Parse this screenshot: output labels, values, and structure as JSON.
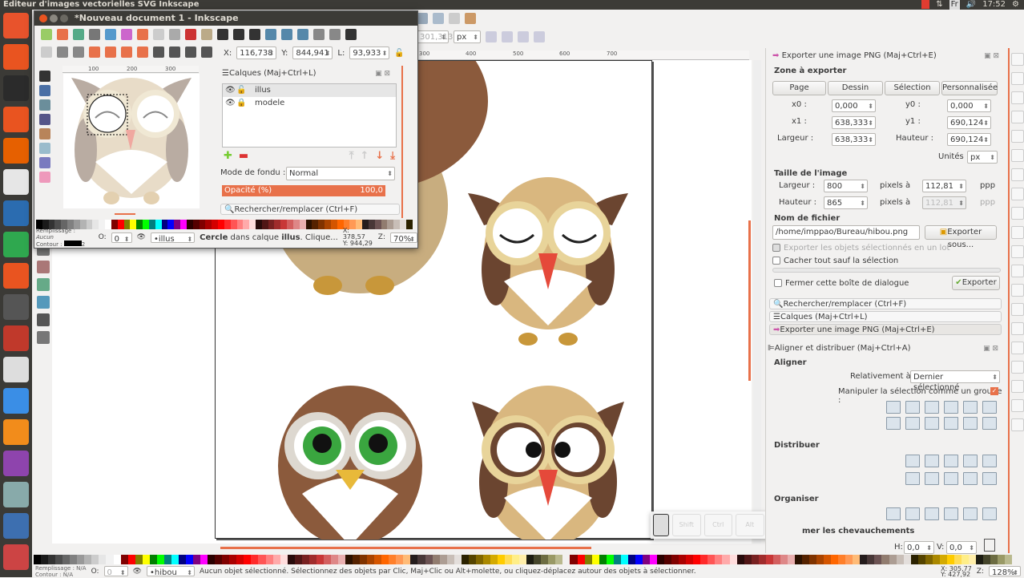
{
  "system": {
    "app_title": "Éditeur d'images vectorielles SVG Inkscape",
    "lang": "Fr",
    "time": "17:52"
  },
  "launcher": {
    "colors": [
      "#e8532c",
      "#e95420",
      "#2b2b2b",
      "#e95420",
      "#e66000",
      "#e6e6e6",
      "#2b6cb0",
      "#2fa84f",
      "#e95420",
      "#555",
      "#c0392b",
      "#ddd",
      "#3a8ee6",
      "#f28c1b",
      "#8e44ad",
      "#8aa",
      "#3d6fb0",
      "#c44"
    ]
  },
  "main": {
    "toolbar": {
      "w_label": "",
      "w_value": "301,313",
      "units": "px"
    },
    "ruler_ticks": [
      "300",
      "400",
      "500",
      "600",
      "700"
    ],
    "status": {
      "fill_label": "Remplissage :",
      "fill_value": "N/A",
      "stroke_label": "Contour :",
      "stroke_value": "N/A",
      "opacity_label": "O:",
      "opacity_value": "0",
      "layer": "•hibou",
      "message": "Aucun objet sélectionné. Sélectionnez des objets par Clic, Maj+Clic ou Alt+molette, ou cliquez-déplacez autour des objets à sélectionner.",
      "x": "X:  305,77",
      "y": "Y:  427,92",
      "zoom_label": "Z:",
      "zoom": "128%"
    }
  },
  "small_window": {
    "title": "*Nouveau document 1 - Inkscape",
    "x_label": "X:",
    "x": "116,738",
    "y_label": "Y:",
    "y": "844,941",
    "l_label": "L:",
    "l": "93,933",
    "ruler_ticks": [
      "100",
      "200",
      "300"
    ],
    "layers_panel": {
      "title": "Calques (Maj+Ctrl+L)",
      "layers": [
        "illus",
        "modele"
      ],
      "blend_label": "Mode de fondu :",
      "blend": "Normal",
      "opacity_label": "Opacité (%)",
      "opacity": "100,0",
      "search": "Rechercher/remplacer (Ctrl+F)"
    },
    "status": {
      "fill_label": "Remplissage :",
      "fill_value": "Aucun",
      "stroke_label": "Contour :",
      "stroke_width": "2",
      "opacity_label": "O:",
      "opacity_value": "0",
      "layer": "•illus",
      "msg_bold1": "Cercle",
      "msg_mid": " dans calque ",
      "msg_bold2": "illus",
      "msg_end": ". Clique...",
      "x": "X:  378,57",
      "y": "Y:  944,29",
      "zoom_label": "Z:",
      "zoom": "70%"
    }
  },
  "export_panel": {
    "title": "Exporter une image PNG (Maj+Ctrl+E)",
    "area_title": "Zone à exporter",
    "area_buttons": [
      "Page",
      "Dessin",
      "Sélection",
      "Personnalisée"
    ],
    "x0_label": "x0 :",
    "x0": "0,000",
    "y0_label": "y0 :",
    "y0": "0,000",
    "x1_label": "x1 :",
    "x1": "638,333",
    "y1_label": "y1 :",
    "y1": "690,124",
    "width_label": "Largeur :",
    "width": "638,333",
    "height_label": "Hauteur :",
    "height": "690,124",
    "units_label": "Unités :",
    "units": "px",
    "size_title": "Taille de l'image",
    "img_width_label": "Largeur :",
    "img_width": "800",
    "px_at": "pixels à",
    "dpi": "112,81",
    "dpi_unit": "ppp",
    "img_height_label": "Hauteur :",
    "img_height": "865",
    "dpi2": "112,81",
    "filename_title": "Nom de fichier",
    "filename": "/home/imppao/Bureau/hibou.png",
    "export_as": "Exporter sous...",
    "batch": "Exporter les objets sélectionnés en un lot",
    "hide_all": "Cacher tout sauf la sélection",
    "close_dialog": "Fermer cette boîte de dialogue",
    "export": "Exporter"
  },
  "collapsed_panels": [
    "Rechercher/remplacer (Ctrl+F)",
    "Calques (Maj+Ctrl+L)",
    "Exporter une image PNG (Maj+Ctrl+E)"
  ],
  "align_panel": {
    "title": "Aligner et distribuer (Maj+Ctrl+A)",
    "align": "Aligner",
    "relative_label": "Relativement à :",
    "relative": "Dernier sélectionné",
    "group_label": "Manipuler la sélection comme un groupe :",
    "group_checked": true,
    "distribute": "Distribuer",
    "organize": "Organiser",
    "overlap": "mer les chevauchements",
    "h_label": "H:",
    "h": "0,0",
    "v_label": "V:",
    "v": "0,0"
  },
  "key_overlay": [
    "Shift",
    "Ctrl",
    "Alt",
    ""
  ],
  "palette": [
    "#000",
    "#1a1a1a",
    "#333",
    "#4d4d4d",
    "#666",
    "#808080",
    "#999",
    "#b3b3b3",
    "#ccc",
    "#e6e6e6",
    "#f2f2f2",
    "#fff",
    "#800000",
    "#f00",
    "#808000",
    "#ff0",
    "#008000",
    "#0f0",
    "#008080",
    "#0ff",
    "#000080",
    "#00f",
    "#800080",
    "#f0f",
    "#2b0000",
    "#550000",
    "#800000",
    "#aa0000",
    "#d40000",
    "#f00",
    "#ff2a2a",
    "#f55",
    "#ff8080",
    "#faa",
    "#fdd",
    "#280b0b",
    "#501616",
    "#782121",
    "#a02c2c",
    "#c83737",
    "#d35f5f",
    "#de8787",
    "#e9afaf",
    "#2b1100",
    "#552200",
    "#803300",
    "#aa4400",
    "#d45500",
    "#f60",
    "#ff7f2a",
    "#f95",
    "#fb7",
    "#241c1c",
    "#483737",
    "#6c5353",
    "#917c6f",
    "#ac9d93",
    "#c8beb7",
    "#e3dedb",
    "#2b2200",
    "#554400",
    "#806600",
    "#aa8800",
    "#d4aa00",
    "#fc0",
    "#fd5",
    "#fe8",
    "#fea",
    "#1c1c12",
    "#45452b",
    "#6c6c42",
    "#999966",
    "#b9b98e",
    "#dede b"
  ]
}
